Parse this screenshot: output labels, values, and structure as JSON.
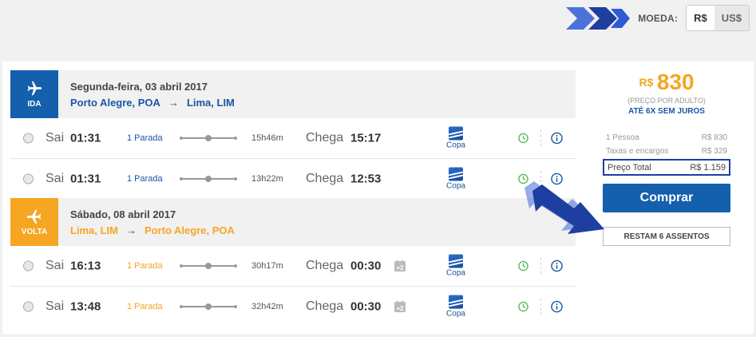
{
  "currency": {
    "label": "MOEDA:",
    "options": [
      "R$",
      "US$"
    ],
    "selected": "R$"
  },
  "legs": [
    {
      "badge": "IDA",
      "color": "#1460ad",
      "date": "Segunda-feira, 03 abril 2017",
      "origin": "Porto Alegre, POA",
      "destination": "Lima, LIM",
      "flights": [
        {
          "depart_label": "Sai",
          "depart": "01:31",
          "stops": "1 Parada",
          "duration": "15h46m",
          "arrive_label": "Chega",
          "arrive": "15:17",
          "next_day": false,
          "airline": "Copa"
        },
        {
          "depart_label": "Sai",
          "depart": "01:31",
          "stops": "1 Parada",
          "duration": "13h22m",
          "arrive_label": "Chega",
          "arrive": "12:53",
          "next_day": false,
          "airline": "Copa"
        }
      ]
    },
    {
      "badge": "VOLTA",
      "color": "#f5a623",
      "date": "Sábado, 08 abril 2017",
      "origin": "Lima, LIM",
      "destination": "Porto Alegre, POA",
      "flights": [
        {
          "depart_label": "Sai",
          "depart": "16:13",
          "stops": "1 Parada",
          "duration": "30h17m",
          "arrive_label": "Chega",
          "arrive": "00:30",
          "next_day": true,
          "airline": "Copa"
        },
        {
          "depart_label": "Sai",
          "depart": "13:48",
          "stops": "1 Parada",
          "duration": "32h42m",
          "arrive_label": "Chega",
          "arrive": "00:30",
          "next_day": true,
          "airline": "Copa"
        }
      ]
    }
  ],
  "summary": {
    "currency_symbol": "R$",
    "price": "830",
    "price_note": "(PREÇO POR ADULTO)",
    "installments": "ATÉ 6X SEM JUROS",
    "breakdown": [
      {
        "label": "1 Pessoa",
        "value": "R$ 830"
      },
      {
        "label": "Taxas e encargos",
        "value": "R$ 329"
      }
    ],
    "total_label": "Preço Total",
    "total_value": "R$ 1.159",
    "buy_label": "Comprar",
    "seats_label": "RESTAM 6 ASSENTOS"
  }
}
